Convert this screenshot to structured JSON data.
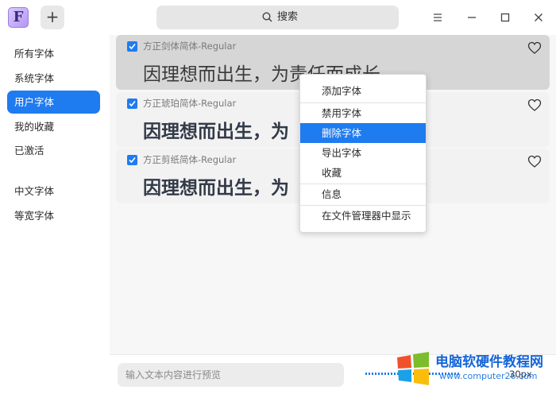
{
  "app": {
    "logo_letter": "F"
  },
  "titlebar": {
    "add_symbol": "+",
    "search_label": "搜索"
  },
  "sidebar": {
    "items": [
      {
        "label": "所有字体",
        "active": false
      },
      {
        "label": "系统字体",
        "active": false
      },
      {
        "label": "用户字体",
        "active": true
      },
      {
        "label": "我的收藏",
        "active": false
      },
      {
        "label": "已激活",
        "active": false
      },
      {
        "label": "中文字体",
        "active": false
      },
      {
        "label": "等宽字体",
        "active": false
      }
    ]
  },
  "fonts": [
    {
      "name": "方正剑体简体-Regular",
      "preview": "因理想而出生，为责任而成长",
      "checked": true,
      "favorite": false
    },
    {
      "name": "方正琥珀简体-Regular",
      "preview": "因理想而出生，为",
      "checked": true,
      "favorite": false
    },
    {
      "name": "方正剪纸简体-Regular",
      "preview": "因理想而出生，为",
      "checked": true,
      "favorite": false
    }
  ],
  "context_menu": {
    "items": [
      {
        "label": "添加字体"
      },
      {
        "label": "禁用字体"
      },
      {
        "label": "删除字体",
        "active": true
      },
      {
        "label": "导出字体"
      },
      {
        "label": "收藏"
      },
      {
        "label": "信息"
      },
      {
        "label": "在文件管理器中显示"
      }
    ]
  },
  "bottombar": {
    "preview_placeholder": "输入文本内容进行预览",
    "size_label": "30px"
  },
  "watermark": {
    "title": "电脑软硬件教程网",
    "url": "www.computer26.com"
  },
  "colors": {
    "accent": "#1f7bf0",
    "hover_card": "#d6d6d6"
  }
}
